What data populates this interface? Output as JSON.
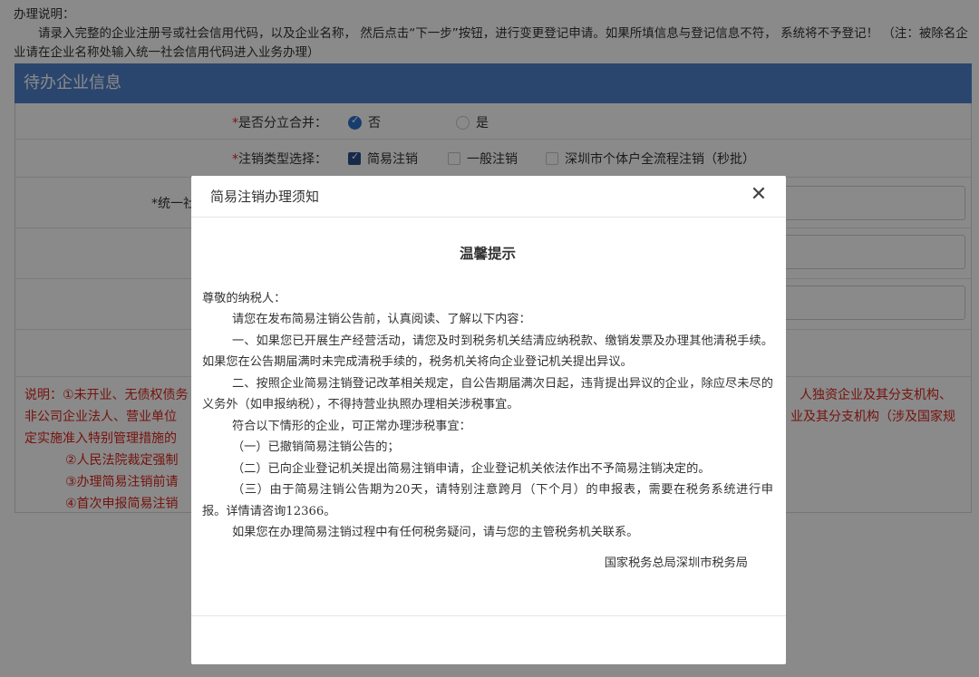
{
  "instructions": {
    "heading": "办理说明：",
    "body": "请录入完整的企业注册号或社会信用代码，以及企业名称， 然后点击“下一步”按钮，进行变更登记申请。如果所填信息与登记信息不符， 系统将不予登记！ （注：被除名企业请在企业名称处输入统一社会信用代码进入业务办理）"
  },
  "section": {
    "title": "待办企业信息"
  },
  "form": {
    "split_merge": {
      "required_mark": "*",
      "label": "是否分立合并：",
      "options": [
        {
          "label": "否",
          "checked": true
        },
        {
          "label": "是",
          "checked": false
        }
      ]
    },
    "cancel_type": {
      "required_mark": "*",
      "label": "注销类型选择：",
      "options": [
        {
          "label": "简易注销",
          "checked": true
        },
        {
          "label": "一般注销",
          "checked": false
        },
        {
          "label": "深圳市个体户全流程注销（秒批）",
          "checked": false
        }
      ]
    },
    "credit_code": {
      "label_partial": "*统一社"
    },
    "note": {
      "line1_left": "说明：①未开业、无债权债务",
      "line1_right": "人独资企业及其分支机构、",
      "line2_left": "非公司企业法人、营业单位",
      "line2_right": "业及其分支机构（涉及国家规",
      "line3": "定实施准入特别管理措施的",
      "items": [
        "②人民法院裁定强制",
        "③办理简易注销前请",
        "④首次申报简易注销"
      ]
    }
  },
  "modal": {
    "title": "简易注销办理须知",
    "notice_title": "温馨提示",
    "greeting": "尊敬的纳税人：",
    "paragraphs": [
      "请您在发布简易注销公告前，认真阅读、了解以下内容：",
      "一、如果您已开展生产经营活动，请您及时到税务机关结清应纳税款、缴销发票及办理其他清税手续。如果您在公告期届满时未完成清税手续的，税务机关将向企业登记机关提出异议。",
      "二、按照企业简易注销登记改革相关规定，自公告期届满次日起，违背提出异议的企业，除应尽未尽的义务外（如申报纳税），不得持营业执照办理相关涉税事宜。",
      "符合以下情形的企业，可正常办理涉税事宜：",
      "（一）已撤销简易注销公告的；",
      "（二）已向企业登记机关提出简易注销申请，企业登记机关依法作出不予简易注销决定的。",
      "（三）由于简易注销公告期为20天，请特别注意跨月（下个月）的申报表，需要在税务系统进行申报。详情请咨询12366。",
      "如果您在办理简易注销过程中有任何税务疑问，请与您的主管税务机关联系。"
    ],
    "signature": "国家税务总局深圳市税务局"
  }
}
